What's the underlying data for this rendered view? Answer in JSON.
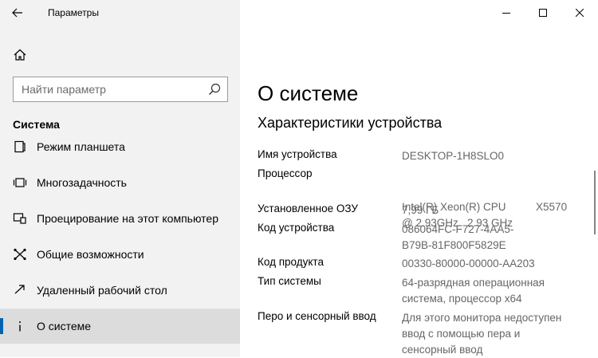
{
  "window": {
    "title": "Параметры"
  },
  "search": {
    "placeholder": "Найти параметр"
  },
  "sidebar": {
    "section": "Система",
    "items": [
      {
        "label": "Режим планшета",
        "icon": "tablet-icon"
      },
      {
        "label": "Многозадачность",
        "icon": "multitask-icon"
      },
      {
        "label": "Проецирование на этот компьютер",
        "icon": "projecting-icon"
      },
      {
        "label": "Общие возможности",
        "icon": "shared-experiences-icon"
      },
      {
        "label": "Удаленный рабочий стол",
        "icon": "remote-desktop-icon"
      },
      {
        "label": "О системе",
        "icon": "info-icon",
        "active": true
      }
    ]
  },
  "main": {
    "title": "О системе",
    "subtitle": "Характеристики устройства",
    "specs": [
      {
        "key": "Имя устройства",
        "value": [
          "DESKTOP-1H8SLO0"
        ]
      },
      {
        "key": "Процессор",
        "value": [
          "Intel(R) Xeon(R) CPU          X5570",
          "@ 2.93GHz   2.93 GHz"
        ]
      },
      {
        "key": "Установленное ОЗУ",
        "value": [
          "7,99 ГБ"
        ]
      },
      {
        "key": "Код устройства",
        "value": [
          "086064FC-F727-4AA5-",
          "B79B-81F800F5829E"
        ]
      },
      {
        "key": "Код продукта",
        "value": [
          "00330-80000-00000-AA203"
        ]
      },
      {
        "key": "Тип системы",
        "value": [
          "64-разрядная операционная",
          "система, процессор x64"
        ]
      },
      {
        "key": "Перо и сенсорный ввод",
        "value": [
          "Для этого монитора недоступен",
          "ввод с помощью пера и",
          "сенсорный ввод"
        ]
      }
    ]
  },
  "colors": {
    "accent": "#0063b1",
    "sidebar_bg": "#f2f2f2",
    "active_bg": "#dcdcdc"
  }
}
